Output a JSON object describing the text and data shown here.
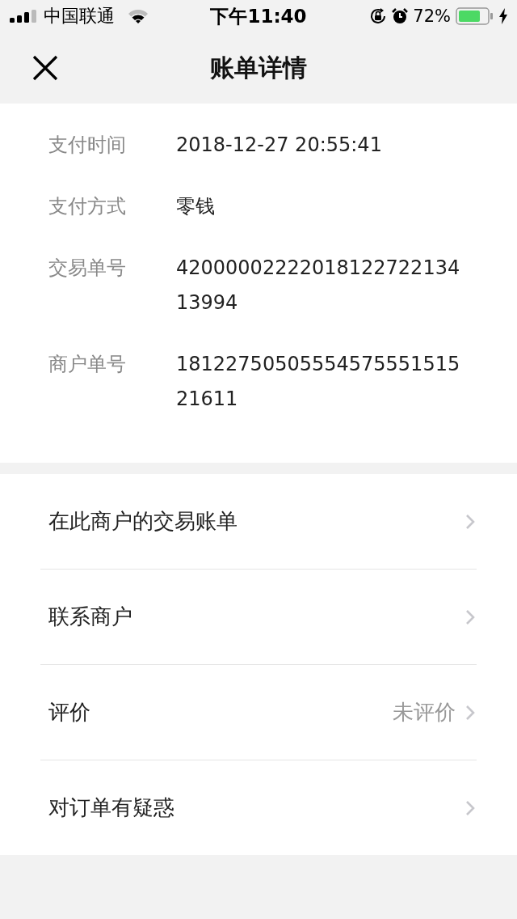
{
  "status_bar": {
    "carrier": "中国联通",
    "time": "下午11:40",
    "battery": "72%"
  },
  "nav": {
    "title": "账单详情"
  },
  "details": [
    {
      "label": "支付时间",
      "value": "2018-12-27 20:55:41"
    },
    {
      "label": "支付方式",
      "value": "零钱"
    },
    {
      "label": "交易单号",
      "value": "4200000222201812272213413994"
    },
    {
      "label": "商户单号",
      "value": "1812275050555457555151521611"
    }
  ],
  "menu": [
    {
      "label": "在此商户的交易账单"
    },
    {
      "label": "联系商户"
    },
    {
      "label": "评价",
      "value": "未评价"
    },
    {
      "label": "对订单有疑惑"
    }
  ]
}
